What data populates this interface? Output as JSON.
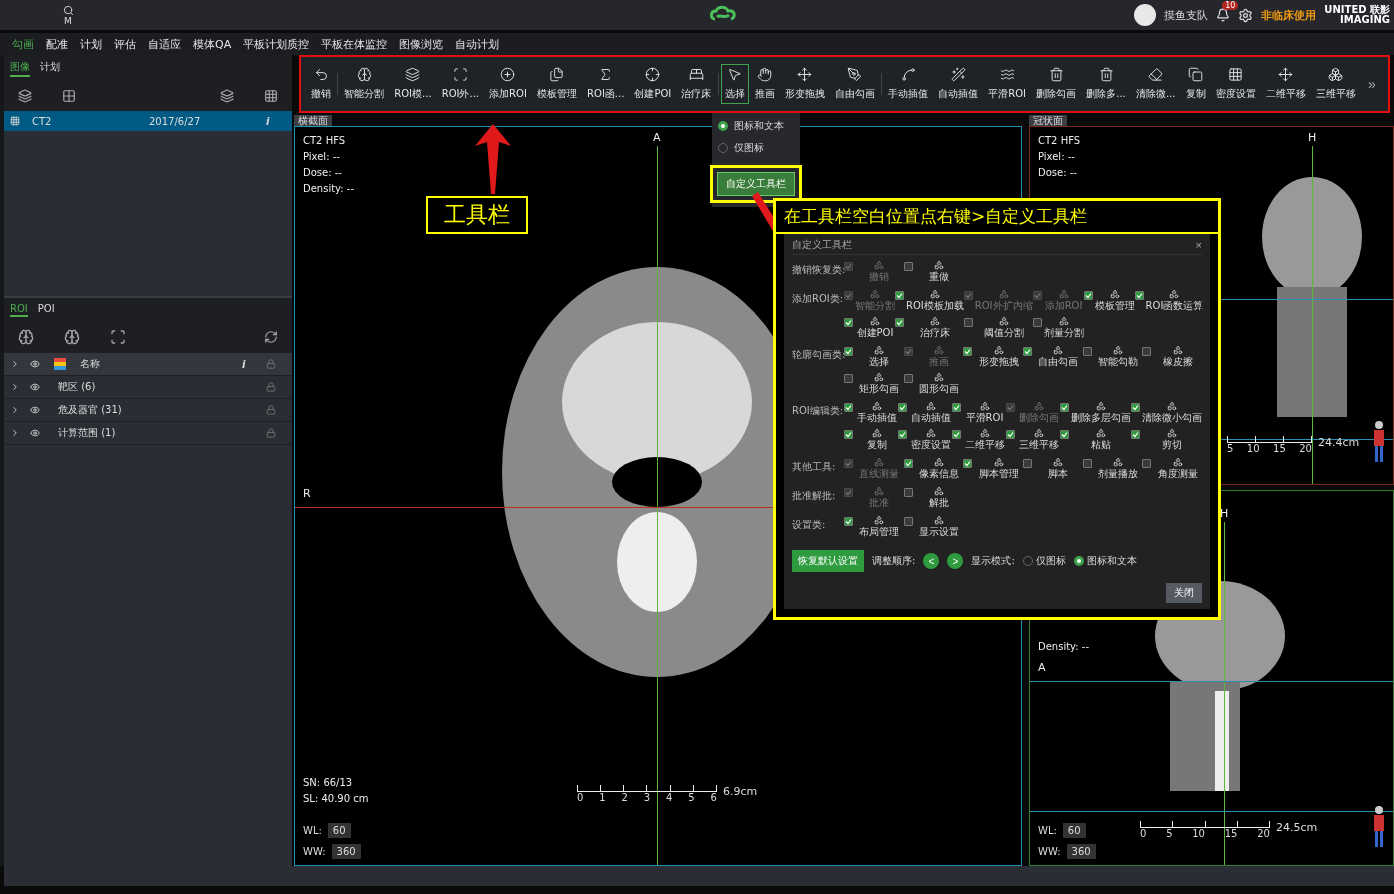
{
  "topbar": {
    "search_label": "M",
    "user": "摸鱼支队",
    "notifications": "10",
    "notice": "非临床使用",
    "brand_top": "UNITED",
    "brand_cn": "联影",
    "brand_bottom": "IMAGING"
  },
  "menu": [
    {
      "label": "勾画",
      "selected": true
    },
    {
      "label": "配准",
      "selected": false
    },
    {
      "label": "计划",
      "selected": false
    },
    {
      "label": "评估",
      "selected": false
    },
    {
      "label": "自适应",
      "selected": false
    },
    {
      "label": "模体QA",
      "selected": false
    },
    {
      "label": "平板计划质控",
      "selected": false
    },
    {
      "label": "平板在体监控",
      "selected": false
    },
    {
      "label": "图像浏览",
      "selected": false
    },
    {
      "label": "自动计划",
      "selected": false
    }
  ],
  "left_panel": {
    "tabs": [
      {
        "label": "图像",
        "selected": true
      },
      {
        "label": "计划",
        "selected": false
      }
    ],
    "images": [
      {
        "name": "CT2",
        "date": "2017/6/27",
        "info": "i",
        "selected": true
      }
    ],
    "roi_tabs": [
      {
        "label": "ROI",
        "selected": true
      },
      {
        "label": "POI",
        "selected": false
      }
    ],
    "roi_header": {
      "name": "名称",
      "info": "i"
    },
    "roi_rows": [
      {
        "label": "靶区 (6)"
      },
      {
        "label": "危及器官 (31)"
      },
      {
        "label": "计算范围 (1)"
      }
    ]
  },
  "toolbar": {
    "groups": [
      [
        {
          "label": "撤销",
          "selected": false
        }
      ],
      [
        {
          "label": "智能分割",
          "selected": false
        },
        {
          "label": "ROI模...",
          "selected": false
        },
        {
          "label": "ROI外...",
          "selected": false
        },
        {
          "label": "添加ROI",
          "selected": false
        },
        {
          "label": "模板管理",
          "selected": false
        },
        {
          "label": "ROI函...",
          "selected": false
        },
        {
          "label": "创建POI",
          "selected": false
        },
        {
          "label": "治疗床",
          "selected": false
        }
      ],
      [
        {
          "label": "选择",
          "selected": true
        },
        {
          "label": "推画",
          "selected": false
        },
        {
          "label": "形变拖拽",
          "selected": false
        },
        {
          "label": "自由勾画",
          "selected": false
        }
      ],
      [
        {
          "label": "手动插值",
          "selected": false
        },
        {
          "label": "自动插值",
          "selected": false
        },
        {
          "label": "平滑ROI",
          "selected": false
        },
        {
          "label": "删除勾画",
          "selected": false
        },
        {
          "label": "删除多...",
          "selected": false
        },
        {
          "label": "清除微...",
          "selected": false
        },
        {
          "label": "复制",
          "selected": false
        },
        {
          "label": "密度设置",
          "selected": false
        },
        {
          "label": "二维平移",
          "selected": false
        },
        {
          "label": "三维平移",
          "selected": false
        }
      ]
    ],
    "more": "»"
  },
  "context_menu": {
    "options": [
      {
        "label": "图标和文本",
        "selected": true
      },
      {
        "label": "仅图标",
        "selected": false
      }
    ],
    "button": "自定义工具栏"
  },
  "views": [
    {
      "title": "横截面",
      "info": [
        "CT2 HFS",
        "Pixel: --",
        "Dose: --",
        "Density: --"
      ],
      "top_letter": "A",
      "side_letter": "R",
      "slice": [
        "SN: 66/13",
        "SL: 40.90 cm"
      ],
      "wl_label": "WL:",
      "wl": "60",
      "ww_label": "WW:",
      "ww": "360",
      "ticks": [
        "0",
        "1",
        "2",
        "3",
        "4",
        "5",
        "6"
      ],
      "scale": "6.9cm"
    },
    {
      "title": "冠状面",
      "info": [
        "CT2 HFS",
        "Pixel: --",
        "Dose: --"
      ],
      "top_letter": "H",
      "ticks": [
        "5",
        "10",
        "15",
        "20"
      ],
      "scale": "24.4cm"
    },
    {
      "info": [
        "Density: --"
      ],
      "top_letter": "H",
      "side_letter": "A",
      "wl_label": "WL:",
      "wl": "60",
      "ww_label": "WW:",
      "ww": "360",
      "ticks": [
        "0",
        "5",
        "10",
        "15",
        "20"
      ],
      "scale": "24.5cm"
    }
  ],
  "annotations": {
    "toolbar_label": "工具栏",
    "dialog_caption": "在工具栏空白位置点右键>自定义工具栏"
  },
  "dialog": {
    "title": "自定义工具栏",
    "close": "×",
    "categories": [
      {
        "label": "撤销恢复类:",
        "items": [
          {
            "label": "撤销",
            "checked": true,
            "disabled": true
          },
          {
            "label": "重做",
            "checked": false,
            "disabled": false
          }
        ]
      },
      {
        "label": "添加ROI类:",
        "items": [
          {
            "label": "智能分割",
            "checked": true,
            "disabled": true
          },
          {
            "label": "ROI模板加载",
            "checked": true,
            "disabled": false
          },
          {
            "label": "ROI外扩内缩",
            "checked": true,
            "disabled": true
          },
          {
            "label": "添加ROI",
            "checked": true,
            "disabled": true
          },
          {
            "label": "模板管理",
            "checked": true,
            "disabled": false
          },
          {
            "label": "ROI函数运算",
            "checked": true,
            "disabled": false
          },
          {
            "label": "创建POI",
            "checked": true,
            "disabled": false
          },
          {
            "label": "治疗床",
            "checked": true,
            "disabled": false
          },
          {
            "label": "阈值分割",
            "checked": false,
            "disabled": false
          },
          {
            "label": "剂量分割",
            "checked": false,
            "disabled": false
          }
        ]
      },
      {
        "label": "轮廓勾画类:",
        "items": [
          {
            "label": "选择",
            "checked": true,
            "disabled": false
          },
          {
            "label": "推画",
            "checked": true,
            "disabled": true
          },
          {
            "label": "形变拖拽",
            "checked": true,
            "disabled": false
          },
          {
            "label": "自由勾画",
            "checked": true,
            "disabled": false
          },
          {
            "label": "智能勾勒",
            "checked": false,
            "disabled": false
          },
          {
            "label": "橡皮擦",
            "checked": false,
            "disabled": false
          },
          {
            "label": "矩形勾画",
            "checked": false,
            "disabled": false
          },
          {
            "label": "圆形勾画",
            "checked": false,
            "disabled": false
          }
        ]
      },
      {
        "label": "ROI编辑类:",
        "items": [
          {
            "label": "手动插值",
            "checked": true,
            "disabled": false
          },
          {
            "label": "自动插值",
            "checked": true,
            "disabled": false
          },
          {
            "label": "平滑ROI",
            "checked": true,
            "disabled": false
          },
          {
            "label": "删除勾画",
            "checked": true,
            "disabled": true
          },
          {
            "label": "删除多层勾画",
            "checked": true,
            "disabled": false
          },
          {
            "label": "清除微小勾画",
            "checked": true,
            "disabled": false
          },
          {
            "label": "复制",
            "checked": true,
            "disabled": false
          },
          {
            "label": "密度设置",
            "checked": true,
            "disabled": false
          },
          {
            "label": "二维平移",
            "checked": true,
            "disabled": false
          },
          {
            "label": "三维平移",
            "checked": true,
            "disabled": false
          },
          {
            "label": "粘贴",
            "checked": true,
            "disabled": false
          },
          {
            "label": "剪切",
            "checked": true,
            "disabled": false
          }
        ]
      },
      {
        "label": "其他工具:",
        "items": [
          {
            "label": "直线测量",
            "checked": true,
            "disabled": true
          },
          {
            "label": "像素信息",
            "checked": true,
            "disabled": false
          },
          {
            "label": "脚本管理",
            "checked": true,
            "disabled": false
          },
          {
            "label": "脚本",
            "checked": false,
            "disabled": false
          },
          {
            "label": "剂量播放",
            "checked": false,
            "disabled": false
          },
          {
            "label": "角度测量",
            "checked": false,
            "disabled": false
          }
        ]
      },
      {
        "label": "批准解批:",
        "items": [
          {
            "label": "批准",
            "checked": true,
            "disabled": true
          },
          {
            "label": "解批",
            "checked": false,
            "disabled": false
          }
        ]
      },
      {
        "label": "设置类:",
        "items": [
          {
            "label": "布局管理",
            "checked": true,
            "disabled": false
          },
          {
            "label": "显示设置",
            "checked": false,
            "disabled": false
          }
        ]
      }
    ],
    "restore": "恢复默认设置",
    "order_label": "调整顺序:",
    "prev": "<",
    "next": ">",
    "display_label": "显示模式:",
    "modes": [
      {
        "label": "仅图标",
        "selected": false
      },
      {
        "label": "图标和文本",
        "selected": true
      }
    ],
    "close_button": "关闭"
  }
}
